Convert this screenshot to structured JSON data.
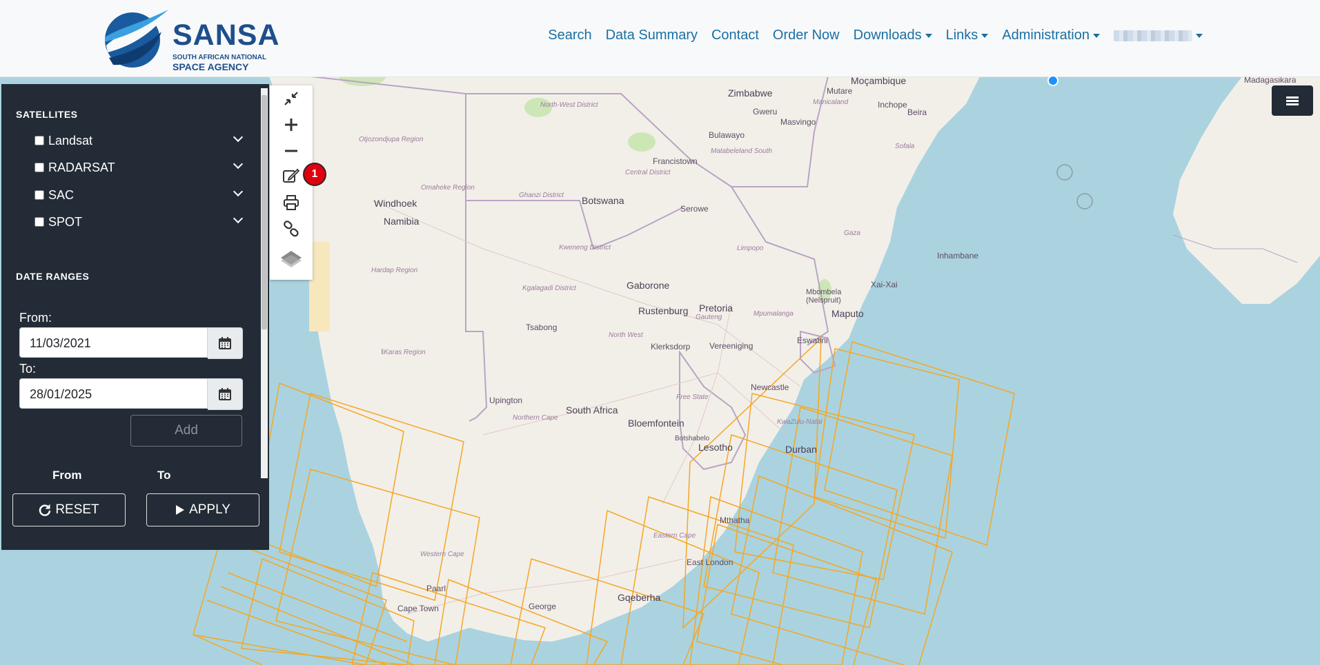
{
  "brand": {
    "title": "SANSA",
    "subtitle1": "SOUTH AFRICAN NATIONAL",
    "subtitle2": "SPACE AGENCY"
  },
  "nav": {
    "items": [
      "Search",
      "Data Summary",
      "Contact",
      "Order Now"
    ],
    "dropdowns": [
      "Downloads",
      "Links",
      "Administration"
    ]
  },
  "sidebar": {
    "satellites_title": "SATELLITES",
    "satellites": [
      "Landsat",
      "RADARSAT",
      "SAC",
      "SPOT"
    ],
    "date_ranges_title": "DATE RANGES",
    "from_label": "From:",
    "from_value": "11/03/2021",
    "to_label": "To:",
    "to_value": "28/01/2025",
    "add_label": "Add",
    "table_from": "From",
    "table_to": "To",
    "reset_label": "RESET",
    "apply_label": "APPLY"
  },
  "toolbar": {
    "badge_count": "1",
    "tools": [
      "collapse-icon",
      "zoom-in-icon",
      "zoom-out-icon",
      "edit-icon",
      "print-icon",
      "link-icon",
      "layers-icon"
    ]
  },
  "map": {
    "countries": [
      "Namibia",
      "Botswana",
      "South Africa",
      "Lesotho",
      "Eswatini",
      "Zimbabwe",
      "Moçambique"
    ],
    "cities": [
      "Windhoek",
      "Gaborone",
      "Pretoria",
      "Rustenburg",
      "Maputo",
      "Durban",
      "Bloemfontein",
      "Cape Town",
      "Paarl",
      "George",
      "Gqeberha",
      "East London",
      "Upington",
      "Bulawayo",
      "Francistown",
      "Beira",
      "Inhambane",
      "Klerksdorp",
      "Vereeniging",
      "Newcastle",
      "Mthatha",
      "Tsabong",
      "Serowe",
      "Gweru",
      "Masvingo",
      "Mutare",
      "Inchope",
      "Xai-Xai",
      "Mbombela (Nelspruit)",
      "Botshabelo",
      "Madagasikara"
    ],
    "regions": [
      "Otjozondjupa Region",
      "Omaheke Region",
      "Hardap Region",
      "ǁKaras Region",
      "Kgalagadi District",
      "Kweneng District",
      "Ghanzi District",
      "Central District",
      "North-West District",
      "Northern Cape",
      "North West",
      "Gauteng",
      "Limpopo",
      "Mpumalanga",
      "KwaZulu-Natal",
      "Eastern Cape",
      "Western Cape",
      "Free State",
      "Matabeleland South",
      "Manicaland",
      "Sofala",
      "Gaza"
    ],
    "colors": {
      "ocean": "#aad3df",
      "land": "#f2efe9",
      "footprint": "#f5a623",
      "border": "#b9a3c4"
    }
  }
}
